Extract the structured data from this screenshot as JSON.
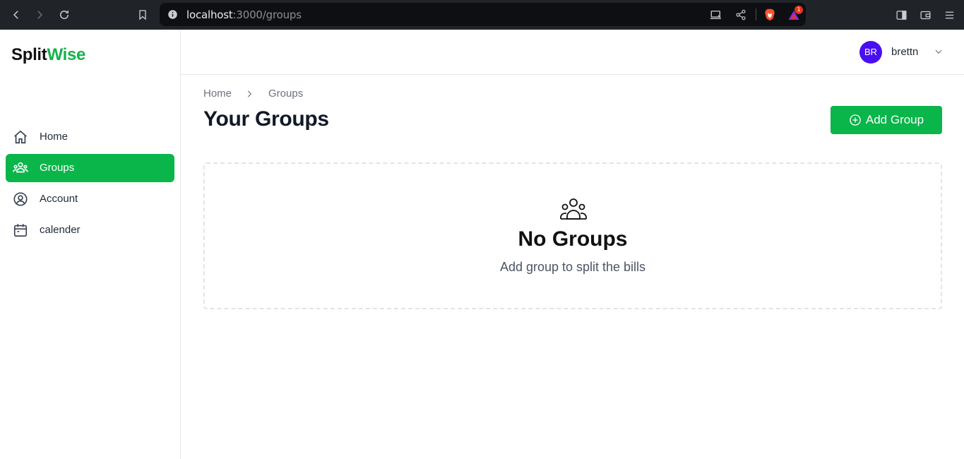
{
  "browser": {
    "url_host": "localhost",
    "url_path": ":3000/groups",
    "notification_count": "1",
    "icons": [
      "back-icon",
      "forward-icon",
      "reload-icon",
      "bookmark-icon",
      "info-icon",
      "cast-icon",
      "share-icon",
      "brave-shield-icon",
      "brave-rewards-icon",
      "sidebar-icon",
      "wallet-icon",
      "menu-icon"
    ]
  },
  "sidebar": {
    "brand_part1": "Split",
    "brand_part2": "Wise",
    "brand_accent_color": "#16b24b",
    "items": [
      {
        "label": "Home",
        "icon": "home-icon",
        "active": false
      },
      {
        "label": "Groups",
        "icon": "users-icon",
        "active": true
      },
      {
        "label": "Account",
        "icon": "user-circle-icon",
        "active": false
      },
      {
        "label": "calender",
        "icon": "calendar-icon",
        "active": false
      }
    ]
  },
  "header": {
    "avatar_initials": "BR",
    "avatar_color": "#4a0ff0",
    "username": "brettn"
  },
  "main": {
    "breadcrumb": [
      "Home",
      "Groups"
    ],
    "title": "Your Groups",
    "add_button_label": "Add Group",
    "primary_color": "#0ab54a",
    "empty_state": {
      "icon": "users-icon",
      "title": "No Groups",
      "subtitle": "Add group to split the bills"
    }
  }
}
